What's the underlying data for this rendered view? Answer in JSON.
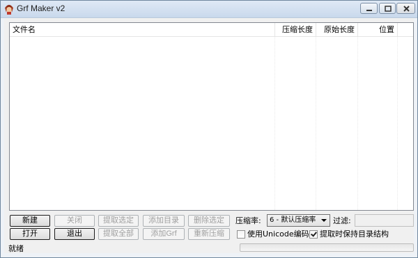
{
  "window": {
    "title": "Grf Maker v2"
  },
  "list": {
    "columns": [
      "文件名",
      "压缩长度",
      "原始长度",
      "位置"
    ],
    "rows": []
  },
  "buttons": {
    "new": "新建",
    "close": "关闭",
    "extract_selected": "提取选定",
    "add_dir": "添加目录",
    "delete_selected": "删除选定",
    "open": "打开",
    "exit": "退出",
    "extract_all": "提取全部",
    "add_grf": "添加Grf",
    "recompress": "重新压缩"
  },
  "compression": {
    "label": "压缩率:",
    "selected": "6 - 默认压缩率"
  },
  "filter": {
    "label": "过滤:",
    "value": ""
  },
  "options": {
    "unicode": {
      "label": "使用Unicode编码",
      "checked": false
    },
    "keep_dirs": {
      "label": "提取时保持目录结构",
      "checked": true
    }
  },
  "status": {
    "text": "就绪",
    "progress": 0
  }
}
